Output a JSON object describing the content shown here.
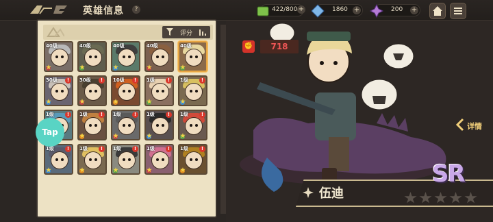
{
  "header": {
    "title": "英雄信息",
    "help_symbol": "?",
    "resources": [
      {
        "name": "stamina",
        "icon": "green-gem-icon",
        "value": "422/800",
        "color": "#7ec24a"
      },
      {
        "name": "diamond",
        "icon": "blue-crystal-icon",
        "value": "1860",
        "color": "#7fb7e8"
      },
      {
        "name": "gem",
        "icon": "purple-crystal-icon",
        "value": "200",
        "color": "#b57bd6"
      }
    ],
    "plus_symbol": "+"
  },
  "list": {
    "sort_label": "评分",
    "tap_label": "Tap",
    "heroes": [
      {
        "level": "40级",
        "badge": "",
        "hair": "#b9b9b9",
        "bg": "#7a6e68",
        "element": "#c04444"
      },
      {
        "level": "40级",
        "badge": "",
        "hair": "#6a6a52",
        "bg": "#5e5e4e",
        "element": "#5aa04a"
      },
      {
        "level": "40级",
        "badge": "",
        "hair": "#3e3e3e",
        "bg": "#5a7a6a",
        "element": "#3c8ad0"
      },
      {
        "level": "40级",
        "badge": "",
        "hair": "#8a6040",
        "bg": "#7a6050",
        "element": "#c04444"
      },
      {
        "level": "40级",
        "badge": "",
        "hair": "#e8d8a0",
        "bg": "#8a6a4a",
        "element": "#5aa04a",
        "selected": true
      },
      {
        "level": "30级",
        "badge": "!",
        "hair": "#c8c0b8",
        "bg": "#6a6470",
        "element": "#3c8ad0"
      },
      {
        "level": "30级",
        "badge": "!",
        "hair": "#4a4030",
        "bg": "#6a5a48",
        "element": "#c04444"
      },
      {
        "level": "10级",
        "badge": "!",
        "hair": "#d06020",
        "bg": "#7a4a30",
        "element": "#e08a20"
      },
      {
        "level": "1级",
        "badge": "!",
        "hair": "#e8d0b0",
        "bg": "#8a7060",
        "element": "#5aa04a"
      },
      {
        "level": "1级",
        "badge": "!",
        "hair": "#d8c060",
        "bg": "#7a6a50",
        "element": "#3c8ad0"
      },
      {
        "level": "1级",
        "badge": "!",
        "hair": "#5a9ab8",
        "bg": "#5a7a80",
        "element": "#3c8ad0"
      },
      {
        "level": "1级",
        "badge": "!",
        "hair": "#c08040",
        "bg": "#6a5040",
        "element": "#e08a20"
      },
      {
        "level": "1级",
        "badge": "!",
        "hair": "#5a5a5a",
        "bg": "#6a6a6a",
        "element": "#c04444"
      },
      {
        "level": "1级",
        "badge": "!",
        "hair": "#2a2a2a",
        "bg": "#5a5050",
        "element": "#3c8ad0"
      },
      {
        "level": "1级",
        "badge": "!",
        "hair": "#d04a3a",
        "bg": "#6a5a50",
        "element": "#5aa04a"
      },
      {
        "level": "1级",
        "badge": "!",
        "hair": "#5a5a6a",
        "bg": "#5a6a7a",
        "element": "#3c8ad0"
      },
      {
        "level": "1级",
        "badge": "!",
        "hair": "#e0c060",
        "bg": "#7a6a50",
        "element": "#e08a20"
      },
      {
        "level": "1级",
        "badge": "!",
        "hair": "#3a3a3a",
        "bg": "#8a8a80",
        "element": "#5aa04a"
      },
      {
        "level": "1级",
        "badge": "!",
        "hair": "#d07090",
        "bg": "#8a6070",
        "element": "#c04444"
      },
      {
        "level": "1级",
        "badge": "!",
        "hair": "#b08020",
        "bg": "#6a5030",
        "element": "#e08a20"
      }
    ]
  },
  "hero": {
    "power": "718",
    "detail_label": "详情",
    "name": "伍迪",
    "rarity": "SR",
    "stars_total": 5
  }
}
